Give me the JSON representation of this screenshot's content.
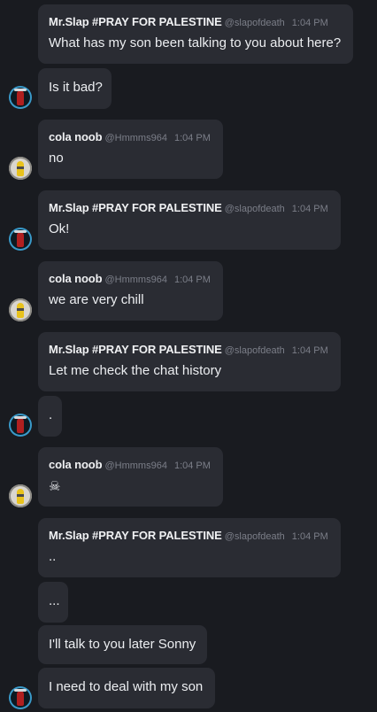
{
  "messages": [
    {
      "type": "header",
      "name": "Mr.Slap #PRAY FOR PALESTINE",
      "handle": "@slapofdeath",
      "time": "1:04 PM",
      "text": "What has my son been talking to you about here?"
    },
    {
      "type": "plain",
      "text": "Is it bad?",
      "avatar": "red"
    },
    {
      "type": "header",
      "name": "cola noob",
      "handle": "@Hmmms964",
      "time": "1:04 PM",
      "text": "no",
      "avatar": "yellow"
    },
    {
      "type": "header",
      "name": "Mr.Slap #PRAY FOR PALESTINE",
      "handle": "@slapofdeath",
      "time": "1:04 PM",
      "text": "Ok!",
      "avatar": "red"
    },
    {
      "type": "header",
      "name": "cola noob",
      "handle": "@Hmmms964",
      "time": "1:04 PM",
      "text": "we are very chill",
      "avatar": "yellow"
    },
    {
      "type": "header",
      "name": "Mr.Slap #PRAY FOR PALESTINE",
      "handle": "@slapofdeath",
      "time": "1:04 PM",
      "text": "Let me check the chat history"
    },
    {
      "type": "plain",
      "text": ".",
      "avatar": "red"
    },
    {
      "type": "header",
      "name": "cola noob",
      "handle": "@Hmmms964",
      "time": "1:04 PM",
      "text": "☠",
      "avatar": "yellow"
    },
    {
      "type": "header",
      "name": "Mr.Slap #PRAY FOR PALESTINE",
      "handle": "@slapofdeath",
      "time": "1:04 PM",
      "text": ".."
    },
    {
      "type": "plain",
      "text": "..."
    },
    {
      "type": "plain",
      "text": "I'll talk to you later Sonny"
    },
    {
      "type": "plain",
      "text": "I need to deal with my son",
      "avatar": "red"
    }
  ]
}
